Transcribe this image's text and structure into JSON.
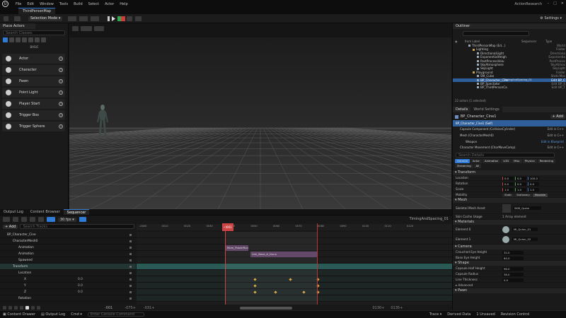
{
  "app": {
    "logo": "U",
    "menu": [
      "File",
      "Edit",
      "Window",
      "Tools",
      "Build",
      "Select",
      "Actor",
      "Help"
    ],
    "project": "ActionResearch",
    "map_tab": "ThirdPersonMap"
  },
  "toolbar": {
    "mode": "Selection Mode",
    "settings": "Settings"
  },
  "place_actors": {
    "tab": "Place Actors",
    "search_placeholder": "Search Classes",
    "category": "BASIC",
    "items": [
      "Actor",
      "Character",
      "Pawn",
      "Point Light",
      "Player Start",
      "Trigger Box",
      "Trigger Sphere"
    ]
  },
  "outliner": {
    "tab": "Outliner",
    "col_label": "Item Label",
    "col_type": "Type",
    "sequence_label": "Sequencer",
    "rows": [
      {
        "name": "ThirdPersonMap (Ed...)",
        "type": "World",
        "indent": 0
      },
      {
        "name": "Lighting",
        "type": "Folder",
        "indent": 1
      },
      {
        "name": "DirectionalLight",
        "type": "Directiona",
        "indent": 2
      },
      {
        "name": "ExponentialHeigh",
        "type": "Exponentia",
        "indent": 2
      },
      {
        "name": "PostProcessVolu",
        "type": "PostProces",
        "indent": 2
      },
      {
        "name": "SkyAtmosphere",
        "type": "SkyAtmos",
        "indent": 2
      },
      {
        "name": "SkyLight",
        "type": "SkyLight",
        "indent": 2
      },
      {
        "name": "Playground",
        "type": "Folder",
        "indent": 1
      },
      {
        "name": "SM_Cube",
        "type": "StaticMes",
        "indent": 2
      },
      {
        "name": "BP_Character_Cine",
        "type": "Edit BP_C",
        "indent": 2,
        "selected": true
      },
      {
        "name": "BP_Spectator",
        "type": "Edit BP_S",
        "indent": 2
      },
      {
        "name": "BP_ThirdPersonCa",
        "type": "Edit BP_T",
        "indent": 2
      }
    ],
    "summary": "22 actors (1 selected)",
    "timing_label": "TimingAndSpacing_01"
  },
  "details": {
    "tab": "Details",
    "tab2": "World Settings",
    "actor_name": "BP_Character_Cine1",
    "add_label": "+ Add",
    "components": [
      {
        "name": "BP_Character_Cine1 (Self)",
        "action": ""
      },
      {
        "name": "Capsule Component (CollisionCylinder)",
        "action": "Edit in C++"
      },
      {
        "name": "Mesh (CharacterMesh0)",
        "action": "Edit in C++"
      },
      {
        "name": "Weapon",
        "action": "Edit in Blueprint"
      },
      {
        "name": "Character Movement (CharMoveComp)",
        "action": "Edit in C++"
      }
    ],
    "search_placeholder": "Search Details",
    "filters": [
      "General",
      "Actor",
      "Animation",
      "LOD",
      "Misc",
      "Physics",
      "Rendering",
      "Streaming",
      "All"
    ],
    "transform_header": "Transform",
    "transform": [
      {
        "label": "Location",
        "x": "0.0",
        "y": "0.0",
        "z": "100.0"
      },
      {
        "label": "Rotation",
        "x": "0.0",
        "y": "0.0",
        "z": "0.0"
      },
      {
        "label": "Scale",
        "x": "1.0",
        "y": "1.0",
        "z": "1.0"
      }
    ],
    "mobility_label": "Mobility",
    "mobility": [
      "Static",
      "Stationary",
      "Movable"
    ],
    "mesh_header": "Mesh",
    "skeletal_mesh_label": "Skeletal Mesh Asset",
    "skeletal_mesh": "SKM_Quinn",
    "skin_cache_label": "Skin Cache Usage",
    "skin_cache": "1 Array element",
    "materials_header": "Materials",
    "materials": [
      {
        "label": "Element 0",
        "name": "MI_Quinn_01"
      },
      {
        "label": "Element 1",
        "name": "MI_Quinn_02"
      }
    ],
    "camera_header": "Camera",
    "crouched_label": "Crouched Eye Height",
    "crouched_value": "32.0",
    "base_eye_label": "Base Eye Height",
    "base_eye_value": "64.0",
    "shape_header": "Shape",
    "half_height_label": "Capsule Half Height",
    "half_height": "96.0",
    "radius_label": "Capsule Radius",
    "radius": "38.0",
    "line_thickness_label": "Line Thickness",
    "line_thickness": "0.0",
    "advanced_label": "Advanced",
    "pawn_header": "Pawn"
  },
  "bottom_tabs": [
    "Output Log",
    "Content Browser",
    "Sequencer"
  ],
  "sequencer": {
    "add_label": "+ Add",
    "search_placeholder": "Search Tracks",
    "fps": "30 fps",
    "current_frame": "-0001",
    "sequence_name": "TimingAndSpacing_01",
    "ruler": [
      "-0000",
      "0010",
      "0020",
      "0030",
      "0040",
      "0050",
      "0060",
      "0070",
      "0080",
      "0090",
      "0100",
      "0110",
      "0120"
    ],
    "tracks": [
      {
        "name": "BP_Character_Cine",
        "indent": 0
      },
      {
        "name": "CharacterMesh0",
        "indent": 1
      },
      {
        "name": "Animation",
        "indent": 2
      },
      {
        "name": "Animation",
        "indent": 2
      },
      {
        "name": "Spawned",
        "indent": 2
      },
      {
        "name": "Transform",
        "indent": 1
      },
      {
        "name": "Location",
        "indent": 2
      },
      {
        "name": "X",
        "indent": 3,
        "value": "0.0"
      },
      {
        "name": "Y",
        "indent": 3,
        "value": "0.0"
      },
      {
        "name": "Z",
        "indent": 3,
        "value": "0.0"
      },
      {
        "name": "Rotation",
        "indent": 2
      }
    ],
    "anim_clips": [
      "Mom_PowerRun",
      "Unk_Base_A_Dunn"
    ],
    "start_frame": "-001",
    "end_frame": "-0001",
    "range_start": "-075+",
    "range_end": "-031+",
    "range_right": "0130+",
    "range_right2": "0135+"
  },
  "status": {
    "content_drawer": "Content Drawer",
    "output_log": "Output Log",
    "cmd": "Cmd",
    "cmd_placeholder": "Enter Console Command",
    "trace": "Trace",
    "derived": "Derived Data",
    "unsaved": "1 Unsaved",
    "revision": "Revision Control"
  },
  "colors": {
    "accent": "#2f7bd6",
    "transform_track": "#2a5a55",
    "anim_clip": "#5c3f63",
    "kf_gold": "#d9a144",
    "kf_red": "#c44"
  }
}
